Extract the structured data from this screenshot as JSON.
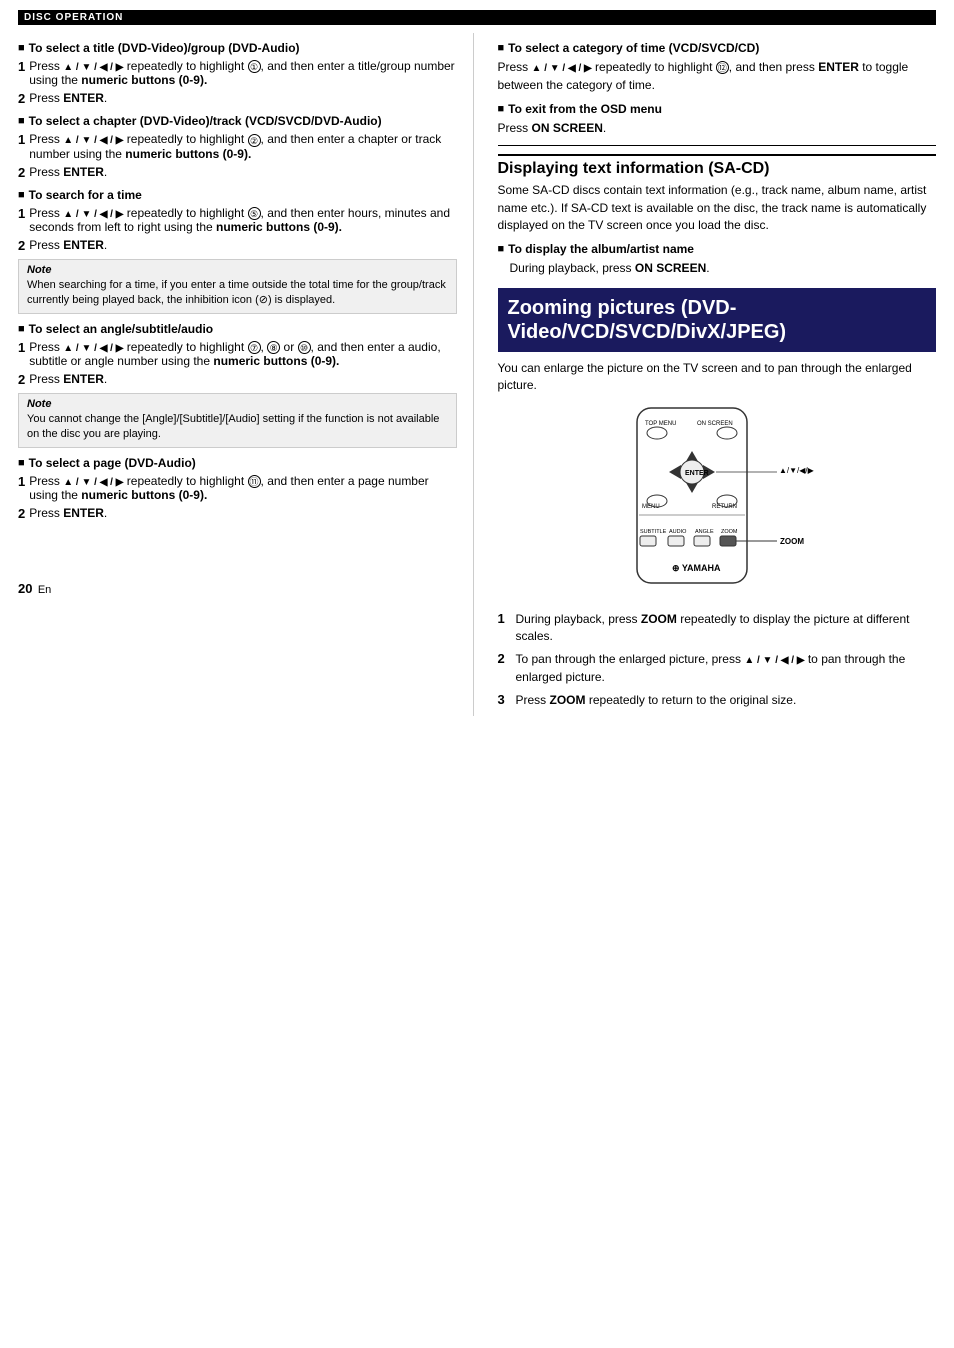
{
  "topBar": {
    "label": "DISC OPERATION"
  },
  "leftCol": {
    "section1": {
      "heading": "To select a title (DVD-Video)/group (DVD-Audio)",
      "step1": {
        "num": "1",
        "text_pre": "Press",
        "icons": "▲ / ▼ / ◀ / ▶",
        "text_mid": "repeatedly to highlight",
        "circled": "①",
        "text_post": ", and then enter a title/group number using the",
        "bold": "numeric buttons (0-9)."
      },
      "step2": {
        "num": "2",
        "text_pre": "Press",
        "bold": "ENTER."
      }
    },
    "section2": {
      "heading": "To select a chapter (DVD-Video)/track (VCD/SVCD/DVD-Audio)",
      "step1": {
        "num": "1",
        "text_pre": "Press",
        "icons": "▲ / ▼ / ◀ / ▶",
        "text_mid": "repeatedly to highlight",
        "circled": "②",
        "text_post": ", and then enter a chapter or track number using the",
        "bold": "numeric buttons (0-9)."
      },
      "step2": {
        "num": "2",
        "text_pre": "Press",
        "bold": "ENTER."
      }
    },
    "section3": {
      "heading": "To search for a time",
      "step1": {
        "num": "1",
        "text_pre": "Press",
        "icons": "▲ / ▼ / ◀ / ▶",
        "text_mid": "repeatedly to highlight",
        "circled": "⑤",
        "text_post": ", and then enter hours, minutes and seconds from left to right using the",
        "bold": "numeric buttons (0-9)."
      },
      "step2": {
        "num": "2",
        "text_pre": "Press",
        "bold": "ENTER."
      }
    },
    "note1": {
      "label": "Note",
      "text": "When searching for a time, if you enter a time outside the total time for the group/track currently being played back, the inhibition icon (⊘) is displayed."
    },
    "section4": {
      "heading": "To select an angle/subtitle/audio",
      "step1": {
        "num": "1",
        "text_pre": "Press",
        "icons": "▲ / ▼ / ◀ / ▶",
        "text_mid": "repeatedly to highlight",
        "circled_a": "⑦",
        "circled_b": "⑧",
        "circled_c": "⑩",
        "text_post": ", and then enter a audio, subtitle or angle number using the",
        "bold": "numeric buttons (0-9)."
      },
      "step2": {
        "num": "2",
        "text_pre": "Press",
        "bold": "ENTER."
      }
    },
    "note2": {
      "label": "Note",
      "text": "You cannot change the [Angle]/[Subtitle]/[Audio] setting if the function is not available on the disc you are playing."
    },
    "section5": {
      "heading": "To select a page (DVD-Audio)",
      "step1": {
        "num": "1",
        "text_pre": "Press",
        "icons": "▲ / ▼ / ◀ / ▶",
        "text_mid": "repeatedly to highlight",
        "circled": "⑪",
        "text_post": ", and then enter a page number using the",
        "bold": "numeric buttons (0-9)."
      },
      "step2": {
        "num": "2",
        "text_pre": "Press",
        "bold": "ENTER."
      }
    }
  },
  "rightCol": {
    "section6": {
      "heading": "To select a category of time (VCD/SVCD/CD)",
      "text_pre": "Press",
      "icons": "▲ / ▼ / ◀ / ▶",
      "text_mid": "repeatedly to highlight",
      "circled": "⑫",
      "text_post": ", and then press",
      "bold": "ENTER",
      "text_end": "to toggle between the category of time."
    },
    "section7": {
      "heading": "To exit from the OSD menu",
      "text_pre": "Press",
      "bold": "ON SCREEN."
    },
    "sacd": {
      "heading": "Displaying text information (SA-CD)",
      "body": "Some SA-CD discs contain text information (e.g., track name, album name, artist name etc.). If SA-CD text is available on the disc, the track name is automatically displayed on the TV screen once you load the disc.",
      "section_album": {
        "heading": "To display the album/artist name",
        "text_pre": "During playback, press",
        "bold": "ON SCREEN."
      }
    },
    "zooming": {
      "heading": "Zooming pictures (DVD-Video/VCD/SVCD/DivX/JPEG)",
      "body": "You can enlarge the picture on the TV screen and to pan through the enlarged picture.",
      "step1": {
        "num": "1",
        "text_pre": "During playback, press",
        "bold": "ZOOM",
        "text_post": "repeatedly to display the picture at different scales."
      },
      "step2": {
        "num": "2",
        "text_pre": "To pan through the enlarged picture, press",
        "icons": "▲ / ▼ / ◀ / ▶",
        "text_post": "to pan through the enlarged picture."
      },
      "step3": {
        "num": "3",
        "text_pre": "Press",
        "bold": "ZOOM",
        "text_post": "repeatedly to return to the original size."
      }
    }
  },
  "pageNum": "20",
  "pageSuffix": "En",
  "remote": {
    "label": "Remote control diagram showing ZOOM button"
  }
}
